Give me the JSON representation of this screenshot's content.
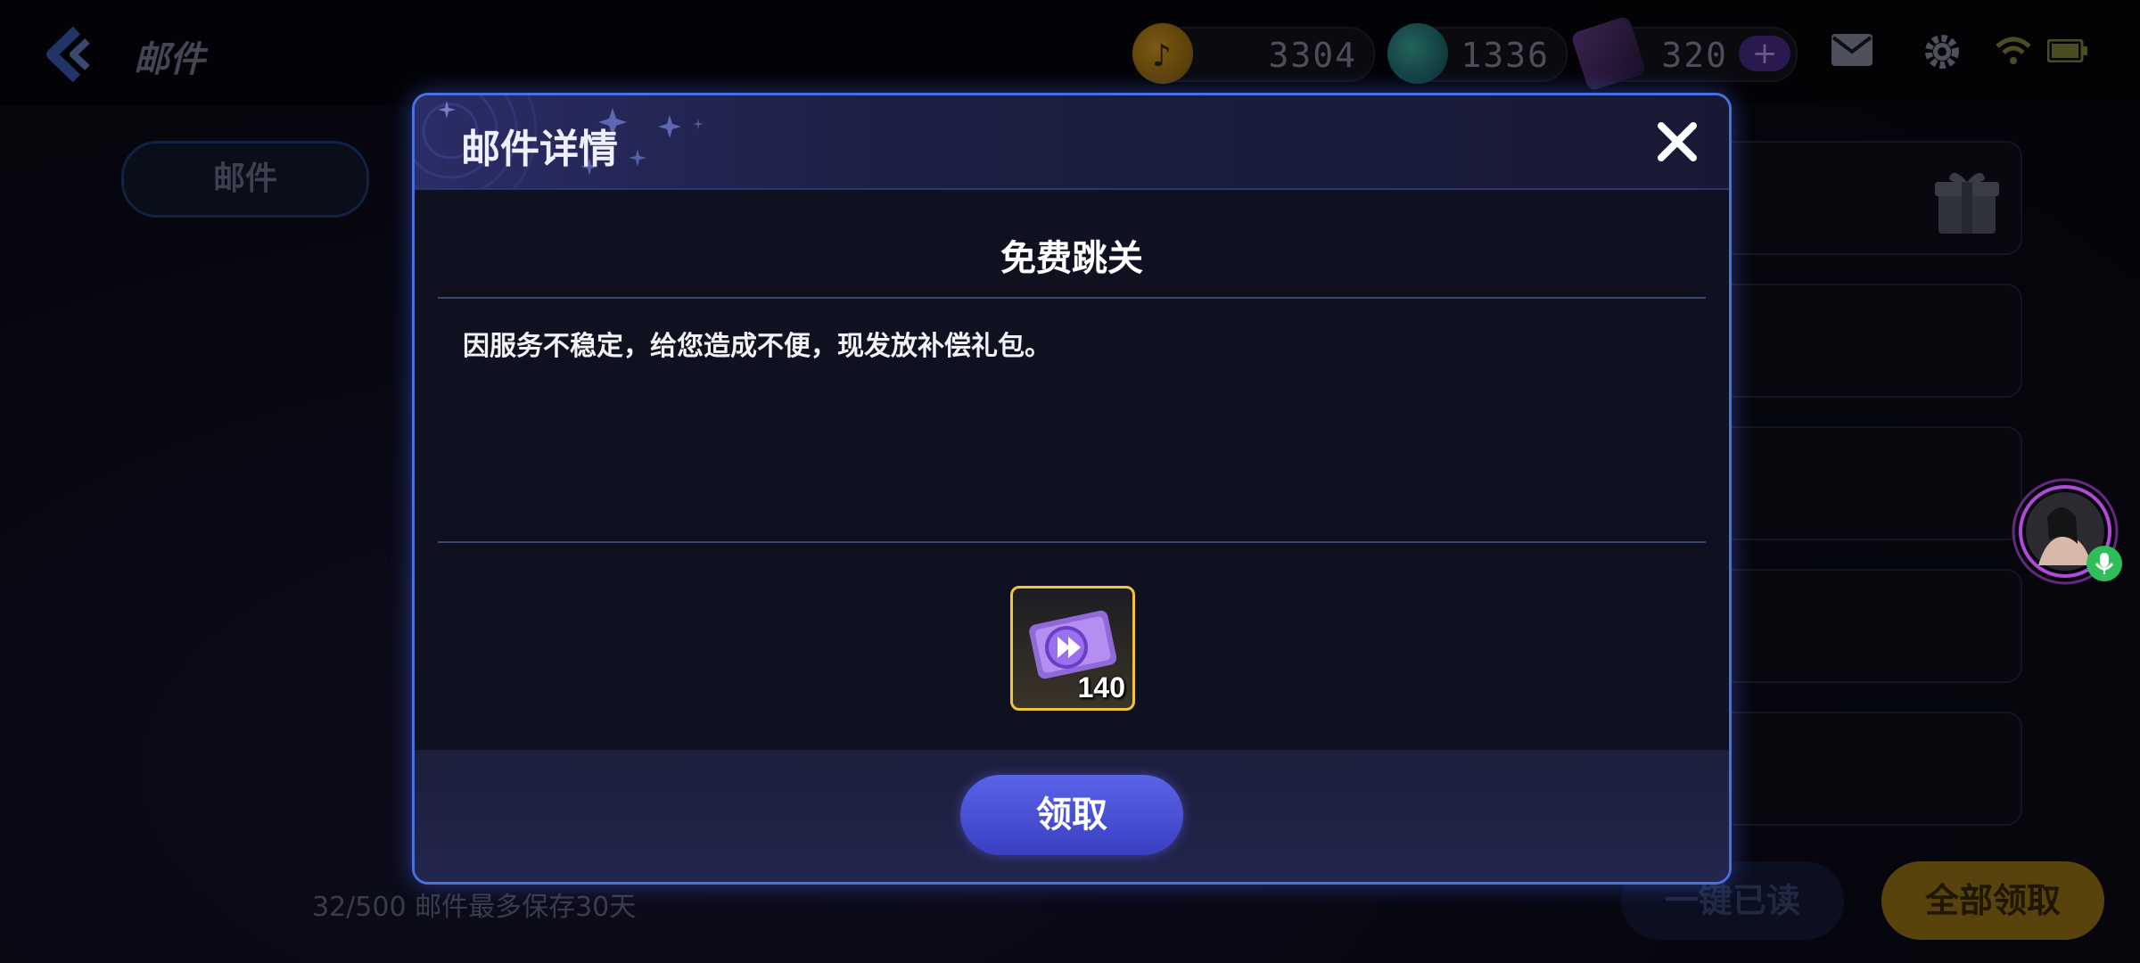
{
  "topbar": {
    "title": "邮件",
    "currencies": [
      {
        "icon": "music-coin-icon",
        "value": "3304"
      },
      {
        "icon": "globe-gem-icon",
        "value": "1336"
      },
      {
        "icon": "ticket-icon",
        "value": "320",
        "plus": "+"
      }
    ],
    "icons": [
      "mail-icon",
      "gear-icon",
      "wifi-icon",
      "battery-icon"
    ]
  },
  "background": {
    "side_tab_label": "邮件",
    "footer_text": "32/500 邮件最多保存30天",
    "read_all_label": "一键已读",
    "claim_all_label": "全部领取"
  },
  "modal": {
    "title": "邮件详情",
    "subject": "免费跳关",
    "body": "因服务不稳定，给您造成不便，现发放补偿礼包。",
    "reward": {
      "icon": "skip-ticket-icon",
      "count": "140"
    },
    "claim_label": "领取"
  },
  "colors": {
    "accent": "#4a6fe0",
    "claim_button": "#4b53d8",
    "reward_border": "#f2c33c"
  }
}
